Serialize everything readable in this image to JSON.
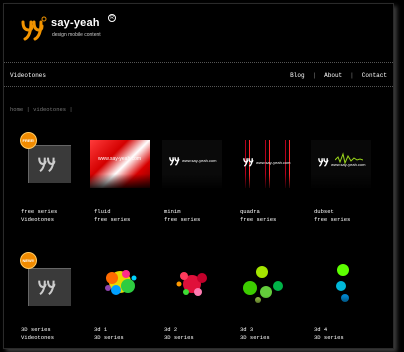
{
  "brand": {
    "name": "say-yeah",
    "registered": "R",
    "tagline": "design mobile content",
    "colors": {
      "accent": "#f29400"
    }
  },
  "nav": {
    "section": "Videotones",
    "links": [
      {
        "label": "Blog"
      },
      {
        "label": "About"
      },
      {
        "label": "Contact"
      }
    ],
    "separator": "|"
  },
  "breadcrumb": {
    "text": "home | videotones |"
  },
  "rows": [
    {
      "items": [
        {
          "title": "free series",
          "subtitle": "Videotones",
          "badge": "FREE!",
          "kind": "box"
        },
        {
          "title": "fluid",
          "subtitle": "free series",
          "kind": "fluid",
          "logo_text": "www.say-yeah.com"
        },
        {
          "title": "minim",
          "subtitle": "free series",
          "kind": "minim",
          "logo_text": "www.say-yeah.com"
        },
        {
          "title": "quadra",
          "subtitle": "free series",
          "kind": "quadra",
          "logo_text": "www.say-yeah.com"
        },
        {
          "title": "dubset",
          "subtitle": "free series",
          "kind": "dubset",
          "logo_text": "www.say-yeah.com"
        }
      ]
    },
    {
      "items": [
        {
          "title": "3D series",
          "subtitle": "Videotones",
          "badge": "NEW!!",
          "kind": "box"
        },
        {
          "title": "3d 1",
          "subtitle": "3D series",
          "kind": "splash1"
        },
        {
          "title": "3d 2",
          "subtitle": "3D series",
          "kind": "splash2"
        },
        {
          "title": "3d 3",
          "subtitle": "3D series",
          "kind": "bubbles"
        },
        {
          "title": "3d 4",
          "subtitle": "3D series",
          "kind": "greenbubbles"
        }
      ]
    }
  ]
}
